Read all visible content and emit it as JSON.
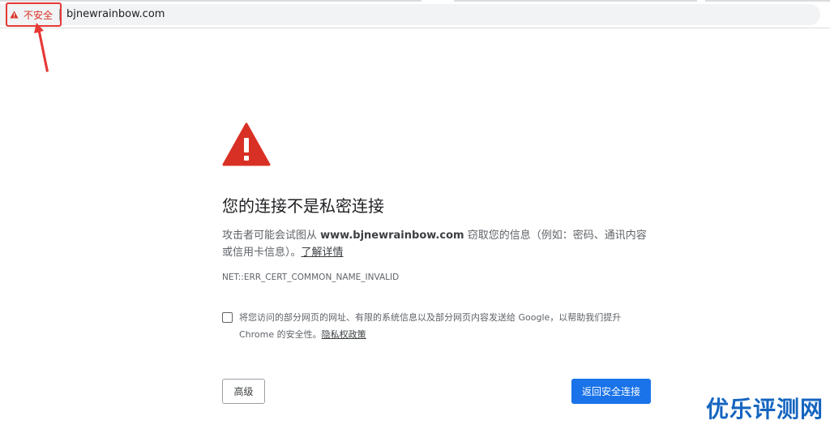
{
  "address_bar": {
    "security_label": "不安全",
    "url": "bjnewrainbow.com",
    "security_color": "#d93025"
  },
  "interstitial": {
    "icon": "warning-triangle-icon",
    "heading": "您的连接不是私密连接",
    "explanation_before": "攻击者可能会试图从 ",
    "domain": "www.bjnewrainbow.com",
    "explanation_after": " 窃取您的信息（例如：密码、通讯内容或信用卡信息）。",
    "learn_more": "了解详情",
    "error_code": "NET::ERR_CERT_COMMON_NAME_INVALID",
    "optin_text": "将您访问的部分网页的网址、有限的系统信息以及部分网页内容发送给 Google，以帮助我们提升 Chrome 的安全性。",
    "privacy_link": "隐私权政策",
    "advanced_button": "高级",
    "back_button": "返回安全连接",
    "accent_color": "#1a73e8",
    "warning_color": "#d93025"
  },
  "watermark": {
    "text": "优乐评测网"
  }
}
